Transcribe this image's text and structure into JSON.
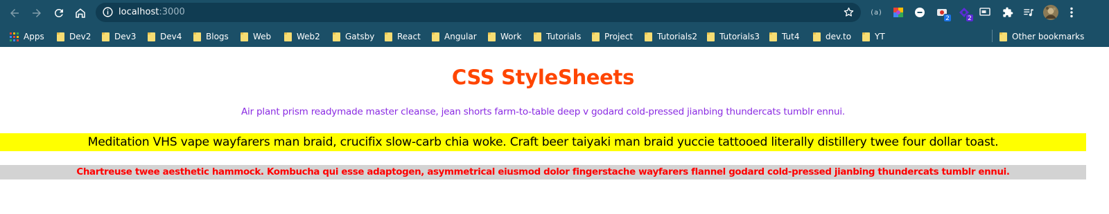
{
  "toolbar": {
    "url_host": "localhost",
    "url_port": ":3000",
    "back_icon": "arrow-left-icon",
    "forward_icon": "arrow-right-icon",
    "reload_icon": "reload-icon",
    "home_icon": "home-icon",
    "extensions": [
      {
        "icon": "extension-parens-icon"
      },
      {
        "icon": "color-picker-icon"
      },
      {
        "icon": "circle-extension-icon"
      },
      {
        "icon": "extension-badge-icon",
        "badge": "2"
      },
      {
        "icon": "purple-extension-icon",
        "badge": "2"
      },
      {
        "icon": "screen-extension-icon"
      },
      {
        "icon": "puzzle-icon"
      },
      {
        "icon": "media-queue-icon"
      },
      {
        "icon": "profile-avatar"
      },
      {
        "icon": "kebab-menu-icon"
      }
    ]
  },
  "bookmarks": {
    "apps_label": "Apps",
    "items": [
      "Dev2",
      "Dev3",
      "Dev4",
      "Blogs",
      "Web",
      "Web2",
      "Gatsby",
      "React",
      "Angular",
      "Work",
      "Tutorials",
      "Project",
      "Tutorials2",
      "Tutorials3",
      "Tut4",
      "dev.to",
      "YT"
    ],
    "other_label": "Other bookmarks"
  },
  "page": {
    "title": "CSS StyleSheets",
    "paragraph_purple": "Air plant prism readymade master cleanse, jean shorts farm-to-table deep v godard cold-pressed jianbing thundercats tumblr ennui.",
    "paragraph_yellow": "Meditation VHS vape wayfarers man braid, crucifix slow-carb chia woke. Craft beer taiyaki man braid yuccie tattooed literally distillery twee four dollar toast.",
    "paragraph_gray": "Chartreuse twee aesthetic hammock. Kombucha qui esse adaptogen, asymmetrical eiusmod dolor fingerstache wayfarers flannel godard cold-pressed jianbing thundercats tumblr ennui."
  },
  "colors": {
    "chrome": "#1b4f67",
    "omnibox": "#103c52",
    "title": "#ff4500",
    "purple_text": "#8a2be2",
    "yellow_bg": "#ffff00",
    "gray_bg": "#d3d3d3",
    "red_text": "#ff0000"
  }
}
